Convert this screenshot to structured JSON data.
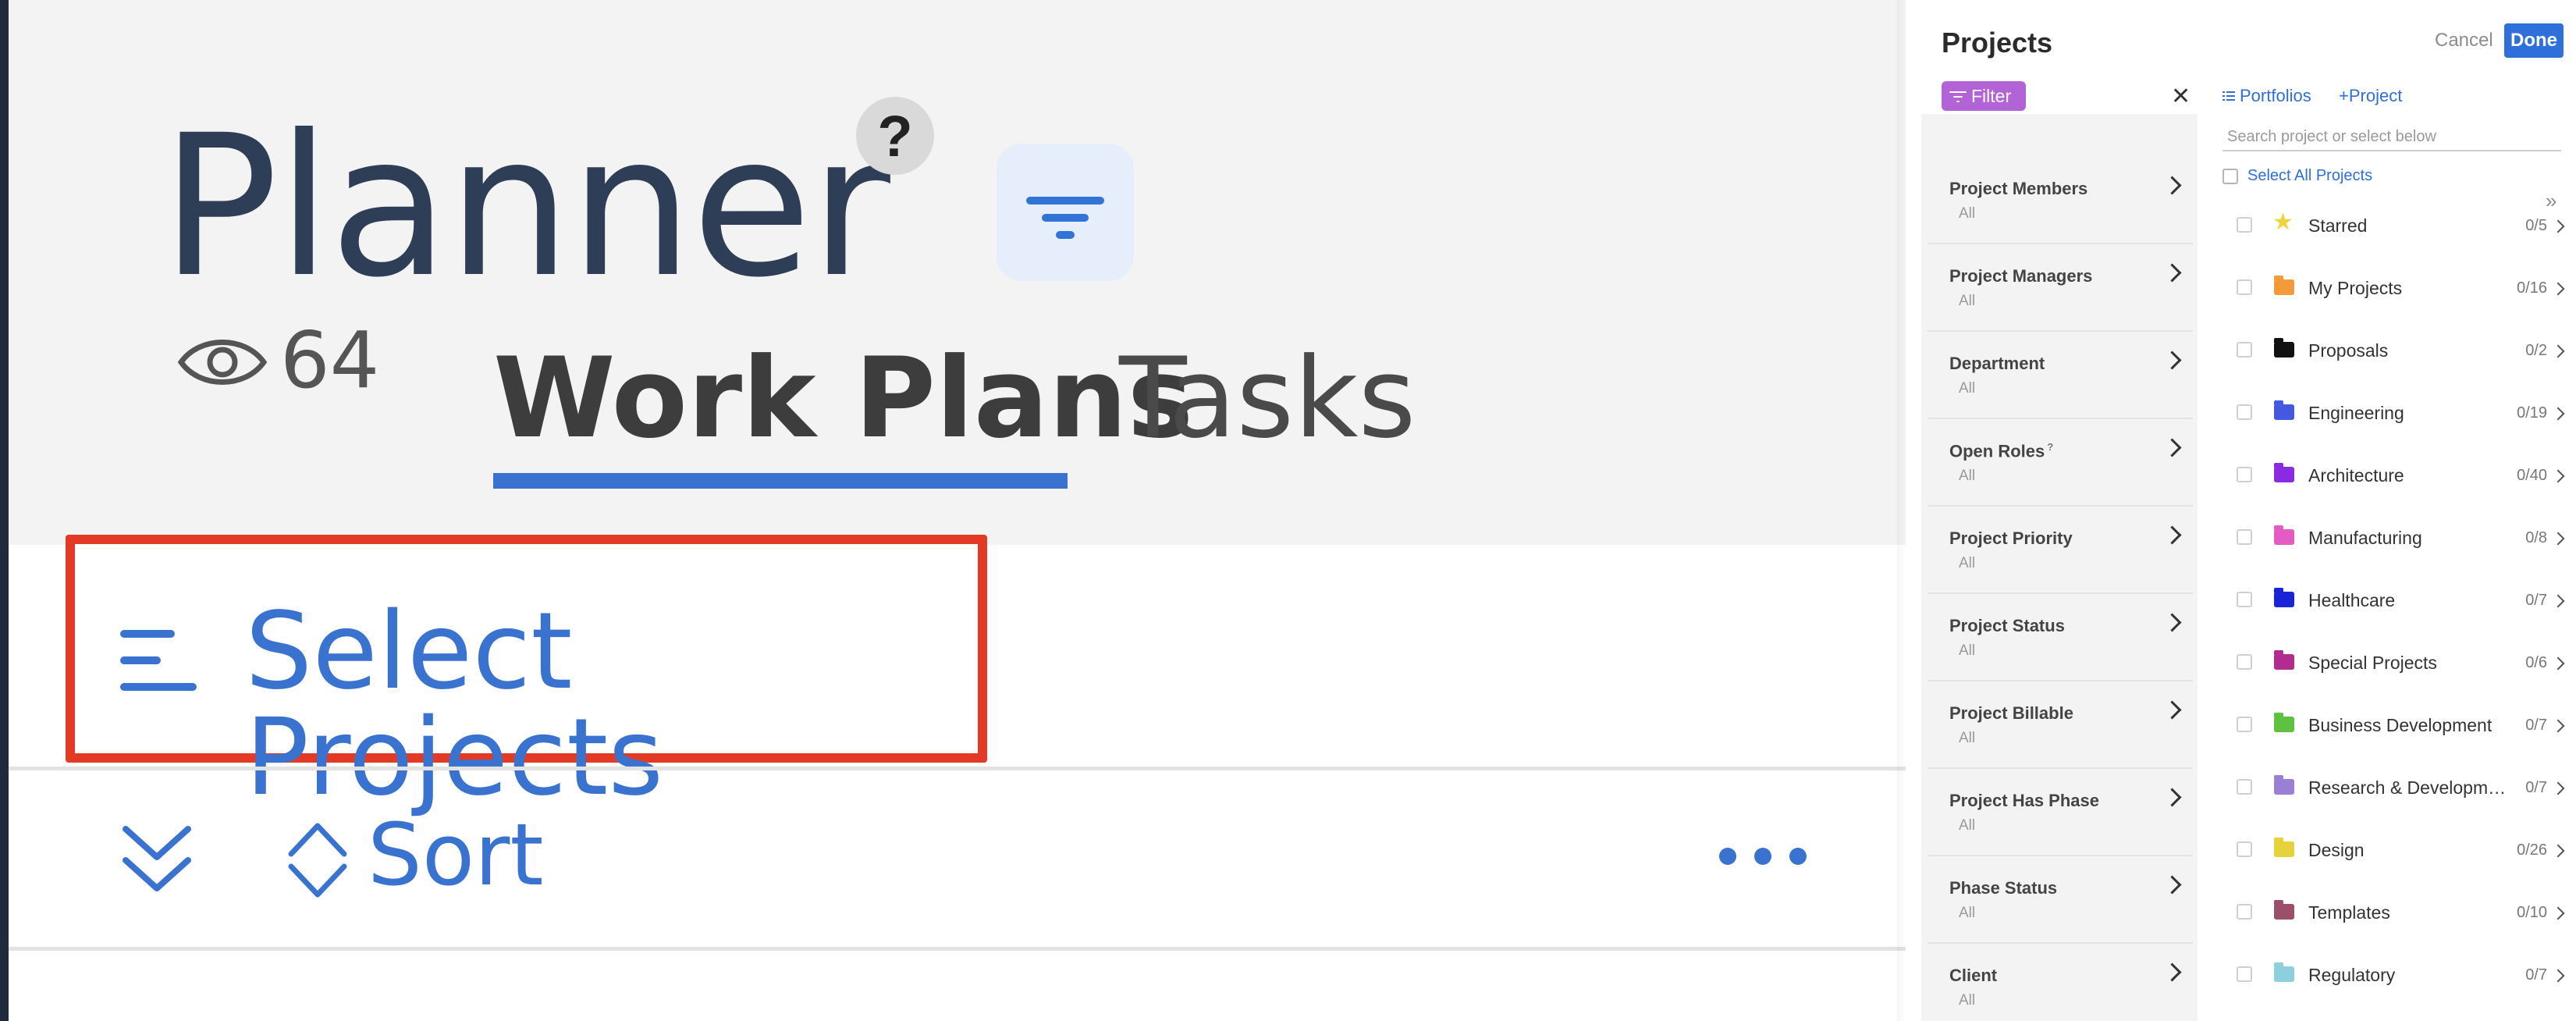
{
  "planner": {
    "title": "Planner",
    "help_label": "?",
    "views_count": "64",
    "tabs": [
      {
        "label": "Work Plans",
        "active": true
      },
      {
        "label": "Tasks",
        "active": false
      }
    ],
    "select_projects_label": "Select Projects",
    "sort_label": "Sort",
    "icons": {
      "filter": "filter-icon",
      "eye": "eye-icon",
      "menu": "menu-icon",
      "collapse": "double-chevron-down-icon",
      "sort": "sort-icon",
      "more": "more-horizontal-icon"
    }
  },
  "modal": {
    "title": "Projects",
    "cancel_label": "Cancel",
    "done_label": "Done",
    "filter_chip_label": "Filter",
    "close_symbol": "✕",
    "filters": [
      {
        "label": "Project Members",
        "value": "All"
      },
      {
        "label": "Project Managers",
        "value": "All"
      },
      {
        "label": "Department",
        "value": "All"
      },
      {
        "label": "Open Roles",
        "value": "All",
        "superscript": "?"
      },
      {
        "label": "Project Priority",
        "value": "All"
      },
      {
        "label": "Project Status",
        "value": "All"
      },
      {
        "label": "Project Billable",
        "value": "All"
      },
      {
        "label": "Project Has Phase",
        "value": "All"
      },
      {
        "label": "Phase Status",
        "value": "All"
      },
      {
        "label": "Client",
        "value": "All"
      }
    ],
    "tab_portfolios": "Portfolios",
    "tab_add_project": "+Project",
    "search_placeholder": "Search project or select below",
    "select_all_label": "Select All Projects",
    "expand_symbol": "»",
    "portfolios": [
      {
        "name": "Starred",
        "count": "0/5",
        "icon": "star-icon",
        "color": "#f2d23a"
      },
      {
        "name": "My Projects",
        "count": "0/16",
        "icon": "folder-icon",
        "color": "#f39a3a"
      },
      {
        "name": "Proposals",
        "count": "0/2",
        "icon": "folder-icon",
        "color": "#111111"
      },
      {
        "name": "Engineering",
        "count": "0/19",
        "icon": "folder-icon",
        "color": "#4559e0"
      },
      {
        "name": "Architecture",
        "count": "0/40",
        "icon": "folder-icon",
        "color": "#8a2be2"
      },
      {
        "name": "Manufacturing",
        "count": "0/8",
        "icon": "folder-icon",
        "color": "#e35bc3"
      },
      {
        "name": "Healthcare",
        "count": "0/7",
        "icon": "folder-icon",
        "color": "#1a23d6"
      },
      {
        "name": "Special Projects",
        "count": "0/6",
        "icon": "folder-icon",
        "color": "#b02d8f"
      },
      {
        "name": "Business Development",
        "count": "0/7",
        "icon": "folder-icon",
        "color": "#5cc23f"
      },
      {
        "name": "Research & Developm…",
        "count": "0/7",
        "icon": "folder-icon",
        "color": "#9a7fd6"
      },
      {
        "name": "Design",
        "count": "0/26",
        "icon": "folder-icon",
        "color": "#e6d23a"
      },
      {
        "name": "Templates",
        "count": "0/10",
        "icon": "folder-icon",
        "color": "#9c4f6a"
      },
      {
        "name": "Regulatory",
        "count": "0/7",
        "icon": "folder-icon",
        "color": "#8ecfdc"
      }
    ]
  }
}
